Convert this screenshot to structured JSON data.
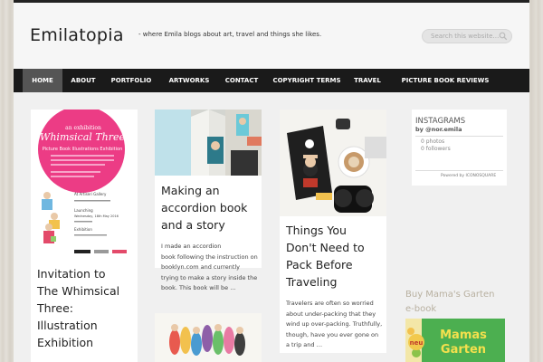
{
  "site": {
    "title": "Emilatopia",
    "tagline": "- where Emila blogs about art, travel and things she likes."
  },
  "search": {
    "placeholder": "Search this website…"
  },
  "nav": {
    "items": [
      {
        "label": "HOME",
        "active": true
      },
      {
        "label": "ABOUT"
      },
      {
        "label": "PORTFOLIO"
      },
      {
        "label": "ARTWORKS"
      },
      {
        "label": "CONTACT"
      },
      {
        "label": "COPYRIGHT TERMS"
      },
      {
        "label": "TRAVEL"
      },
      {
        "label": "PICTURE BOOK REVIEWS"
      }
    ]
  },
  "posts": [
    {
      "title": [
        "Invitation to",
        "The Whimsical",
        "Three:",
        "Illustration",
        "Exhibition"
      ],
      "image": "whimsical-three-poster-image",
      "poster_text": {
        "line1": "Whimsical Three",
        "line2": "Picture Book Illustrations Exhibition",
        "venue": "At Artiseri Gallery",
        "date": "Wednesday, 18th May 2016"
      }
    },
    {
      "title": [
        "Making an",
        "accordion book",
        "and a story"
      ],
      "excerpt": [
        "I made an accordion",
        "book following the instruction on",
        "booklyn.com and currently",
        "trying to make a story inside the",
        "book.   This book will be …"
      ],
      "image": "accordion-book-image"
    },
    {
      "title": [
        "Things You",
        "Don't Need to",
        "Pack Before",
        "Traveling"
      ],
      "excerpt": [
        "Travelers are often so worried",
        "about under-packing that they",
        "wind up over-packing. Truthfully,",
        "though, have you ever gone on",
        "a trip and …"
      ],
      "image": "travel-flatlay-image"
    },
    {
      "title": [],
      "image": "colorful-figures-image"
    }
  ],
  "sidebar": {
    "instagram": {
      "title": "INSTAGRAMS",
      "user": "by @nor.emila",
      "photos": "0 photos",
      "followers": "0 followers",
      "powered": "Powered by ICONOSQUARE"
    },
    "buy": {
      "title": [
        "Buy Mama's Garten",
        "e-book"
      ],
      "badge": "neu",
      "cover_text": [
        "Mamas",
        "Garten"
      ]
    }
  },
  "colors": {
    "nav_bg": "#1a1a1a",
    "nav_active": "#555555",
    "header_bg": "#f6f6f6"
  }
}
